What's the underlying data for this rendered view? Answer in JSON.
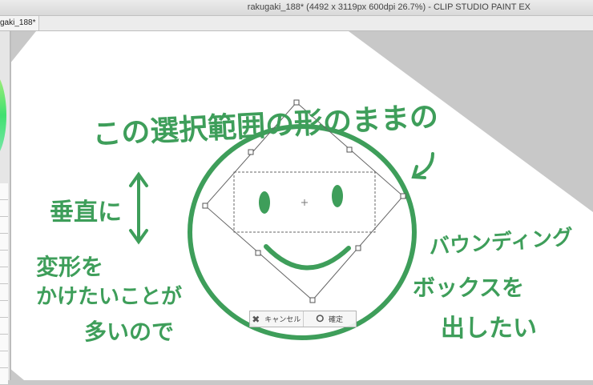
{
  "window": {
    "title": "rakugaki_188* (4492 x 3119px 600dpi 26.7%)  - CLIP STUDIO PAINT EX",
    "tab": "gaki_188*"
  },
  "colors": {
    "ink": "#3e9e5a",
    "background": "#c8c8c8",
    "paper": "#ffffff"
  },
  "transform_bar": {
    "cancel_label": "キャンセル",
    "cancel_icon": "x-icon",
    "confirm_label": "確定",
    "confirm_icon": "circle-icon"
  },
  "handwriting": {
    "top": "この選択範囲の形のままの",
    "vertical": "垂直に",
    "left": [
      "変形を",
      "かけたいことが",
      "多いので"
    ],
    "right": [
      "バウンディング",
      "ボックスを",
      "出したい"
    ]
  }
}
